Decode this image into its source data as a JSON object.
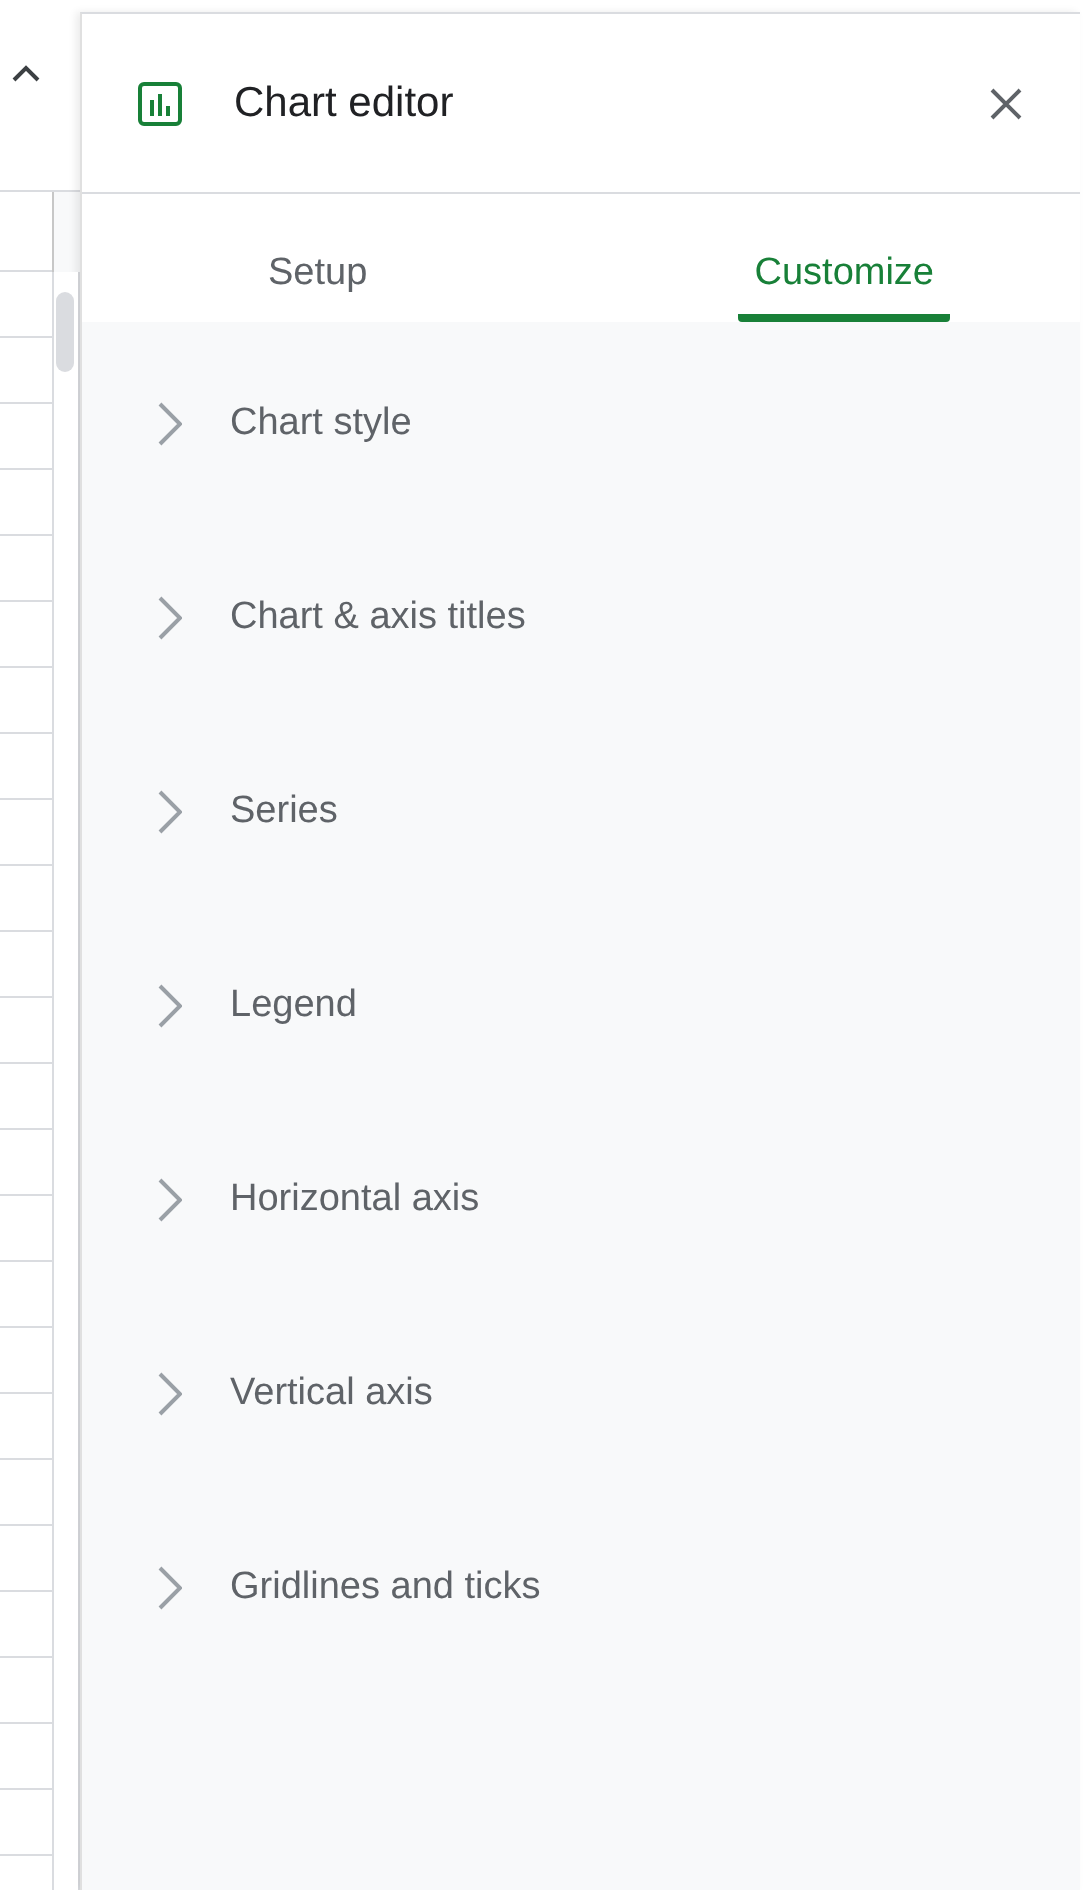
{
  "panel": {
    "title": "Chart editor"
  },
  "tabs": [
    {
      "label": "Setup",
      "selected": false
    },
    {
      "label": "Customize",
      "selected": true
    }
  ],
  "sections": [
    {
      "label": "Chart style",
      "expanded": false
    },
    {
      "label": "Chart & axis titles",
      "expanded": false
    },
    {
      "label": "Series",
      "expanded": false
    },
    {
      "label": "Legend",
      "expanded": false
    },
    {
      "label": "Horizontal axis",
      "expanded": false
    },
    {
      "label": "Vertical axis",
      "expanded": false
    },
    {
      "label": "Gridlines and ticks",
      "expanded": false
    }
  ]
}
